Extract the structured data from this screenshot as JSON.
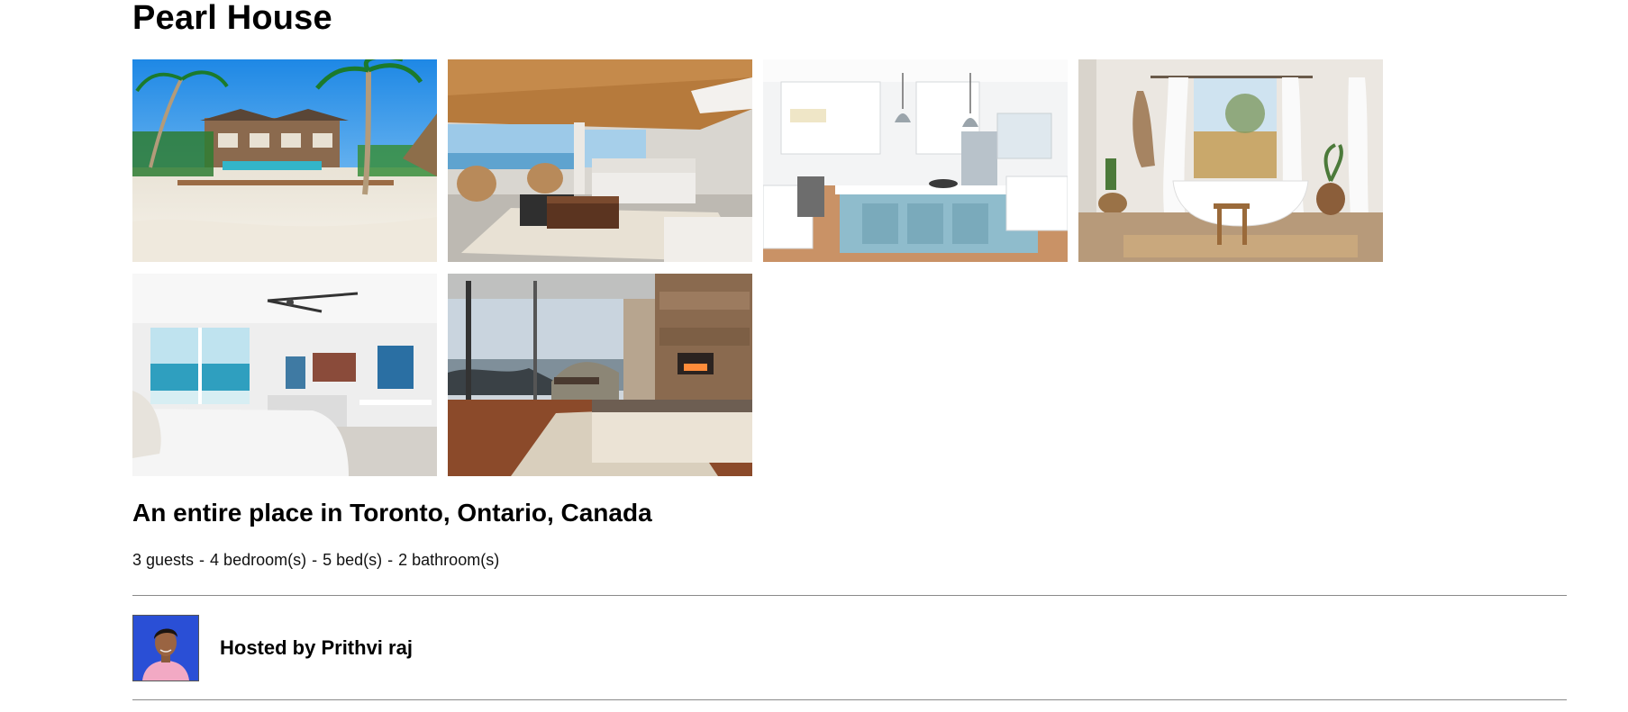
{
  "listing": {
    "title": "Pearl House",
    "subtitle": "An entire place in Toronto, Ontario, Canada",
    "details": {
      "guests": "3 guests",
      "bedrooms": "4 bedroom(s)",
      "beds": "5 bed(s)",
      "bathrooms": "2 bathroom(s)",
      "separator": "-"
    }
  },
  "gallery": {
    "photos": [
      {
        "name": "beach-villa-photo"
      },
      {
        "name": "living-room-photo"
      },
      {
        "name": "kitchen-photo"
      },
      {
        "name": "bathroom-photo"
      },
      {
        "name": "bedroom-ocean-photo"
      },
      {
        "name": "bedroom-fireplace-photo"
      }
    ]
  },
  "host": {
    "label": "Hosted by Prithvi raj",
    "avatar_background": "#2a4fd6"
  },
  "colors": {
    "text": "#000000",
    "divider": "#8a8a8a",
    "background": "#ffffff"
  }
}
